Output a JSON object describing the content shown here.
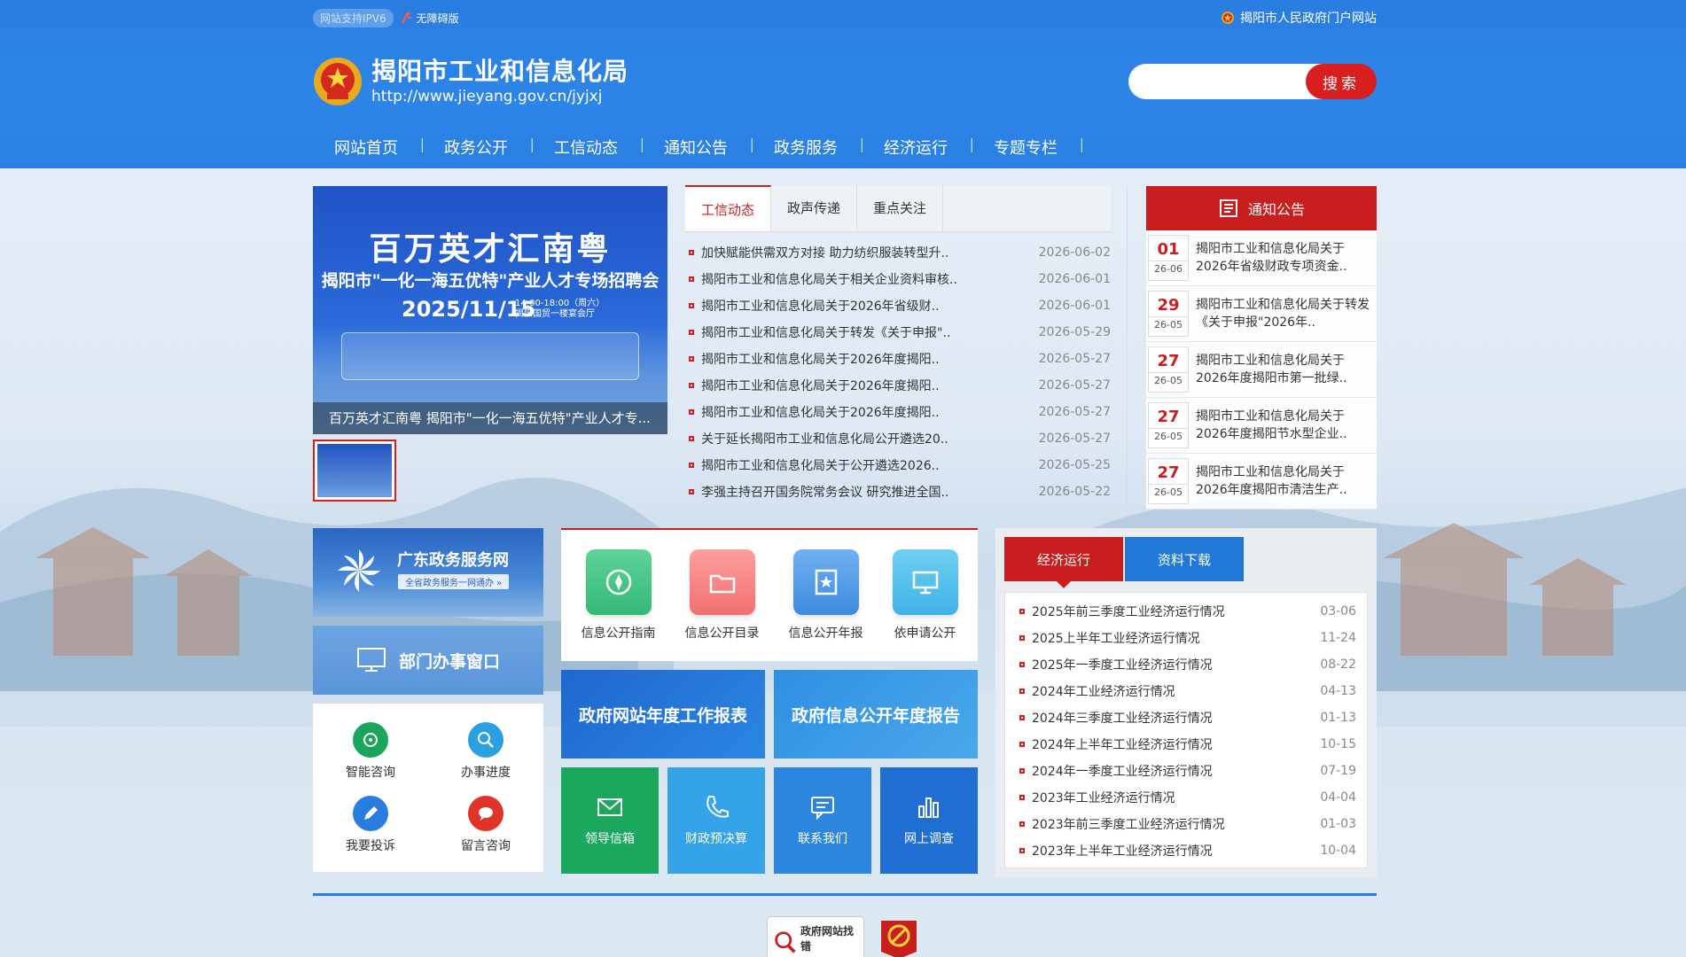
{
  "topbar": {
    "ipv6": "网站支持IPV6",
    "accessibility": "无障碍版",
    "portal": "揭阳市人民政府门户网站"
  },
  "brand": {
    "title": "揭阳市工业和信息化局",
    "url": "http://www.jieyang.gov.cn/jyjxj"
  },
  "search": {
    "placeholder": "",
    "button": "搜索"
  },
  "nav": [
    "网站首页",
    "政务公开",
    "工信动态",
    "通知公告",
    "政务服务",
    "经济运行",
    "专题专栏"
  ],
  "slide": {
    "title": "百万英才汇南粤",
    "subtitle": "揭阳市\"一化一海五优特\"产业人才专场招聘会",
    "date": "2025/11/15",
    "time": "14:00-18:00（周六）",
    "place": "揭阳国贸一楼宴会厅",
    "caption": "百万英才汇南粤 揭阳市\"一化一海五优特\"产业人才专..."
  },
  "news": {
    "tabs": [
      "工信动态",
      "政声传递",
      "重点关注"
    ],
    "items": [
      {
        "title": "加快赋能供需双方对接 助力纺织服装转型升..",
        "date": "2026-06-02"
      },
      {
        "title": "揭阳市工业和信息化局关于相关企业资料审核..",
        "date": "2026-06-01"
      },
      {
        "title": "揭阳市工业和信息化局关于2026年省级财..",
        "date": "2026-06-01"
      },
      {
        "title": "揭阳市工业和信息化局关于转发《关于申报\"..",
        "date": "2026-05-29"
      },
      {
        "title": "揭阳市工业和信息化局关于2026年度揭阳..",
        "date": "2026-05-27"
      },
      {
        "title": "揭阳市工业和信息化局关于2026年度揭阳..",
        "date": "2026-05-27"
      },
      {
        "title": "揭阳市工业和信息化局关于2026年度揭阳..",
        "date": "2026-05-27"
      },
      {
        "title": "关于延长揭阳市工业和信息化局公开遴选20..",
        "date": "2026-05-27"
      },
      {
        "title": "揭阳市工业和信息化局关于公开遴选2026..",
        "date": "2026-05-25"
      },
      {
        "title": "李强主持召开国务院常务会议 研究推进全国..",
        "date": "2026-05-22"
      }
    ]
  },
  "notice": {
    "title": "通知公告",
    "items": [
      {
        "day": "01",
        "ym": "26-06",
        "text": "揭阳市工业和信息化局关于2026年省级财政专项资金.."
      },
      {
        "day": "29",
        "ym": "26-05",
        "text": "揭阳市工业和信息化局关于转发《关于申报\"2026年.."
      },
      {
        "day": "27",
        "ym": "26-05",
        "text": "揭阳市工业和信息化局关于2026年度揭阳市第一批绿.."
      },
      {
        "day": "27",
        "ym": "26-05",
        "text": "揭阳市工业和信息化局关于2026年度揭阳节水型企业.."
      },
      {
        "day": "27",
        "ym": "26-05",
        "text": "揭阳市工业和信息化局关于2026年度揭阳市清洁生产.."
      }
    ]
  },
  "services": {
    "gd_title": "广东政务服务网",
    "gd_sub": "全省政务服务一网通办 »",
    "dept": "部门办事窗口",
    "quick": [
      "智能咨询",
      "办事进度",
      "我要投诉",
      "留言咨询"
    ]
  },
  "publicity": {
    "icons": [
      "信息公开指南",
      "信息公开目录",
      "信息公开年报",
      "依申请公开"
    ],
    "reports": [
      "政府网站年度工作报表",
      "政府信息公开年度报告"
    ],
    "tiles": [
      "领导信箱",
      "财政预决算",
      "联系我们",
      "网上调查"
    ]
  },
  "economy": {
    "tabs": [
      "经济运行",
      "资料下载"
    ],
    "items": [
      {
        "title": "2025年前三季度工业经济运行情况",
        "date": "03-06"
      },
      {
        "title": "2025上半年工业经济运行情况",
        "date": "11-24"
      },
      {
        "title": "2025年一季度工业经济运行情况",
        "date": "08-22"
      },
      {
        "title": "2024年工业经济运行情况",
        "date": "04-13"
      },
      {
        "title": "2024年三季度工业经济运行情况",
        "date": "01-13"
      },
      {
        "title": "2024年上半年工业经济运行情况",
        "date": "10-15"
      },
      {
        "title": "2024年一季度工业经济运行情况",
        "date": "07-19"
      },
      {
        "title": "2023年工业经济运行情况",
        "date": "04-04"
      },
      {
        "title": "2023年前三季度工业经济运行情况",
        "date": "01-03"
      },
      {
        "title": "2023年上半年工业经济运行情况",
        "date": "10-04"
      }
    ]
  },
  "footer": {
    "gov_badge": "政府网站找错"
  },
  "colors": {
    "header_blue": "#2a7de0",
    "accent_red": "#c81e1e",
    "tab_blue": "#2178d6"
  }
}
